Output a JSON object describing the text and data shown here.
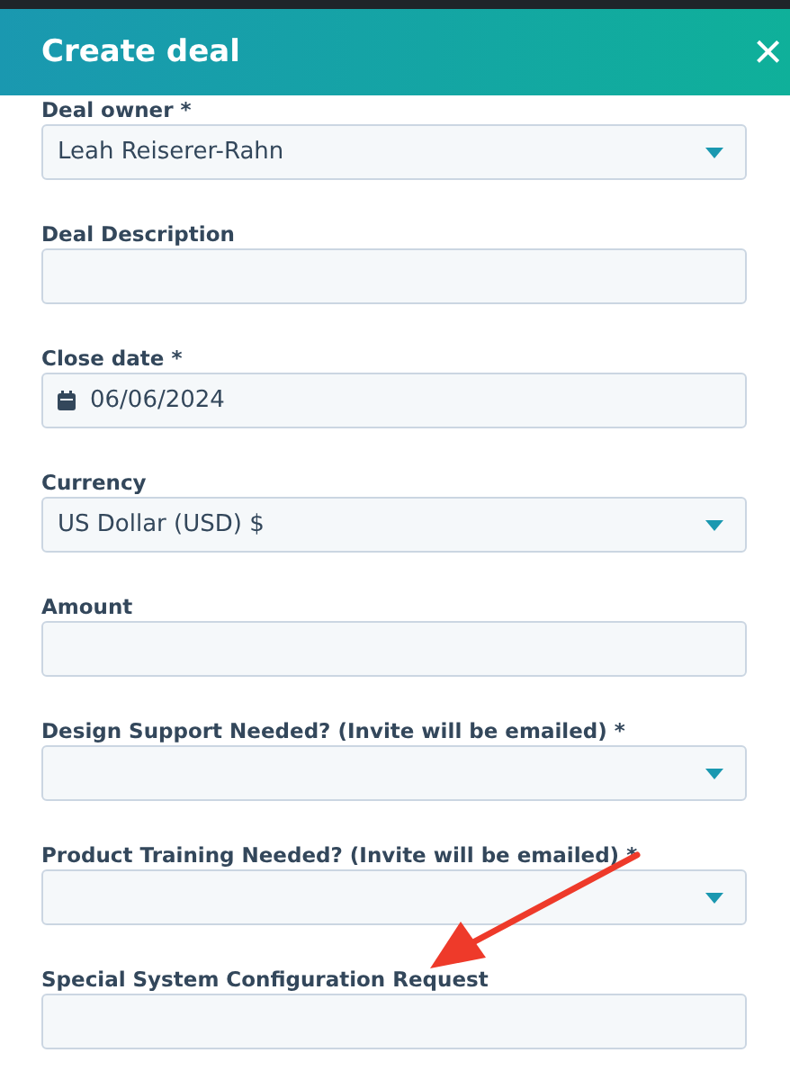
{
  "dialog": {
    "title": "Create deal",
    "close": "×"
  },
  "fields": [
    {
      "label": "Deal owner *",
      "kind": "select",
      "value": "Leah Reiserer-Rahn"
    },
    {
      "label": "Deal Description",
      "kind": "text"
    },
    {
      "label": "Close date *",
      "kind": "date",
      "value": "06/06/2024"
    },
    {
      "label": "Currency",
      "kind": "select",
      "value": "US Dollar (USD) $"
    },
    {
      "label": "Amount",
      "kind": "text"
    },
    {
      "label": "Design Support Needed? (Invite will be emailed) *",
      "kind": "select"
    },
    {
      "label": "Product Training Needed? (Invite will be emailed) *",
      "kind": "select"
    },
    {
      "label": "Special System Configuration Request",
      "kind": "text"
    }
  ]
}
